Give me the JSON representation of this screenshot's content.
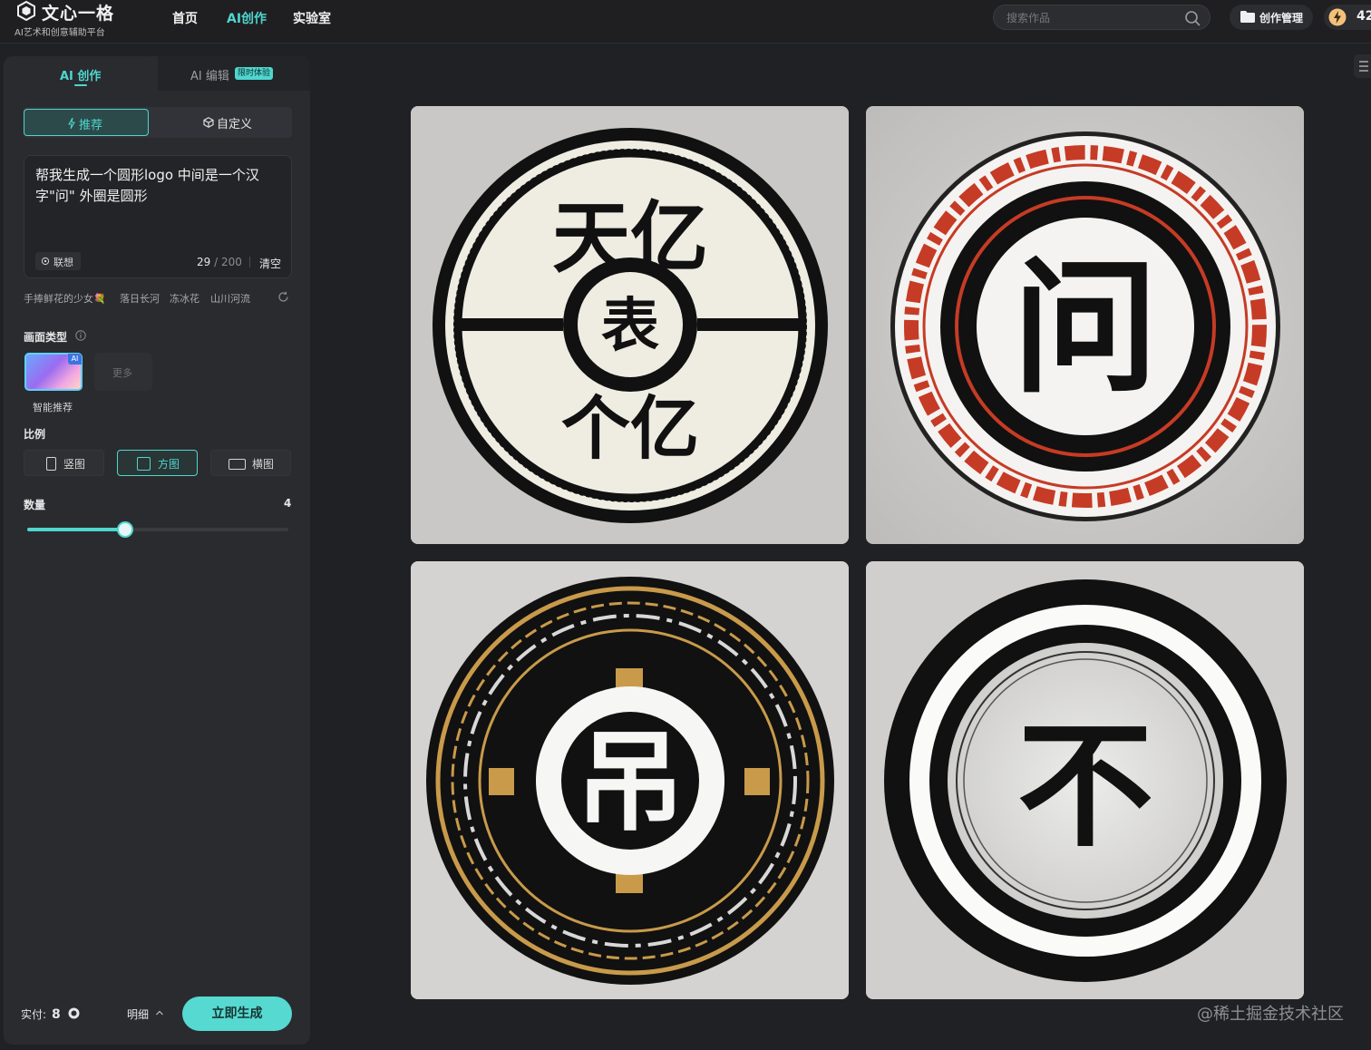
{
  "app": {
    "title": "文心一格",
    "subtitle": "AI艺术和创意辅助平台"
  },
  "nav": {
    "items": [
      {
        "label": "首页",
        "active": false
      },
      {
        "label": "AI创作",
        "active": true
      },
      {
        "label": "实验室",
        "active": false
      }
    ]
  },
  "search": {
    "placeholder": "搜索作品"
  },
  "header_actions": {
    "manage_label": "创作管理",
    "points": "42"
  },
  "tabs": {
    "create": "AI 创作",
    "edit": "AI 编辑",
    "edit_badge": "限时体验"
  },
  "mode": {
    "recommend": "推荐",
    "custom": "自定义"
  },
  "prompt": {
    "text": "帮我生成一个圆形logo 中间是一个汉字\"问\" 外圈是圆形",
    "associate": "联想",
    "count": "29",
    "max": "200",
    "clear": "清空"
  },
  "suggestions": [
    "手捧鲜花的少女💐",
    "落日长河",
    "冻冰花",
    "山川河流"
  ],
  "picture_type": {
    "label": "画面类型",
    "smart_label": "智能推荐",
    "smart_badge": "AI",
    "more_label": "更多"
  },
  "ratio": {
    "label": "比例",
    "options": [
      {
        "label": "竖图",
        "active": false
      },
      {
        "label": "方图",
        "active": true
      },
      {
        "label": "横图",
        "active": false
      }
    ]
  },
  "quantity": {
    "label": "数量",
    "value": "4",
    "min": 1,
    "max": 9,
    "fraction": 0.375
  },
  "footer": {
    "pay_label": "实付:",
    "pay_value": "8",
    "detail_label": "明细",
    "generate_label": "立即生成"
  },
  "results": [
    {
      "name": "logo-result-1",
      "glyph_top": "天亿",
      "glyph_center": "表",
      "glyph_bottom": "个亿"
    },
    {
      "name": "logo-result-2",
      "glyph_center": "问"
    },
    {
      "name": "logo-result-3",
      "glyph_center": "吊"
    },
    {
      "name": "logo-result-4",
      "glyph_center": "不"
    }
  ],
  "watermark": "@稀土掘金技术社区",
  "colors": {
    "accent": "#4fd6cf",
    "background": "#202124",
    "panel": "#2a2b2f",
    "generate_button": "#56d9d0"
  }
}
